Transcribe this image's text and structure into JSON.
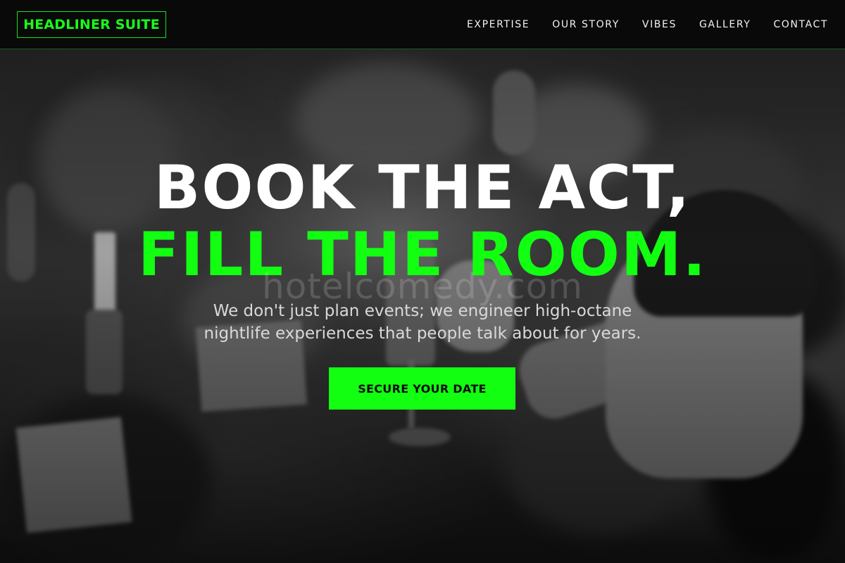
{
  "colors": {
    "accent": "#12FF12",
    "header_bg": "#080808",
    "text_primary": "#FFFFFF",
    "text_secondary": "#D9D9D9"
  },
  "header": {
    "logo": "HEADLINER SUITE",
    "nav": [
      {
        "label": "EXPERTISE"
      },
      {
        "label": "OUR STORY"
      },
      {
        "label": "VIBES"
      },
      {
        "label": "GALLERY"
      },
      {
        "label": "CONTACT"
      }
    ]
  },
  "hero": {
    "headline_line1": "BOOK THE ACT,",
    "headline_line2": "FILL THE ROOM.",
    "watermark": "hotelcomedy.com",
    "subtitle_line1": "We don't just plan events; we engineer high-octane",
    "subtitle_line2": "nightlife experiences that people talk about for years.",
    "cta_label": "SECURE YOUR DATE"
  }
}
